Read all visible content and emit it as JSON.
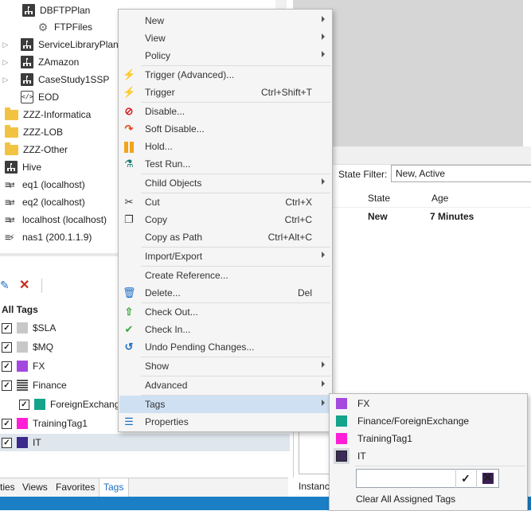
{
  "tree": {
    "rows": [
      {
        "label": "DBFTPPlan",
        "icon": "plan-icon"
      },
      {
        "label": "FTPFiles",
        "icon": "gear-icon"
      },
      {
        "label": "ServiceLibraryPlan",
        "icon": "plan-icon"
      },
      {
        "label": "ZAmazon",
        "icon": "plan-icon"
      },
      {
        "label": "CaseStudy1SSP",
        "icon": "plan-icon"
      },
      {
        "label": "EOD",
        "icon": "code-icon"
      },
      {
        "label": "ZZZ-Informatica",
        "icon": "folder-icon"
      },
      {
        "label": "ZZZ-LOB",
        "icon": "folder-icon"
      },
      {
        "label": "ZZZ-Other",
        "icon": "folder-icon"
      },
      {
        "label": "Hive",
        "icon": "plan-icon"
      },
      {
        "label": "eq1 (localhost)",
        "icon": "agent-icon"
      },
      {
        "label": "eq2 (localhost)",
        "icon": "agent-icon"
      },
      {
        "label": "localhost (localhost)",
        "icon": "agent-icon"
      },
      {
        "label": "nas1 (200.1.1.9)",
        "icon": "agent-icon"
      }
    ]
  },
  "tags_pane": {
    "header": "All Tags",
    "items": [
      {
        "label": "$SLA",
        "color": "#c8c8c8",
        "checked": true
      },
      {
        "label": "$MQ",
        "color": "#c8c8c8",
        "checked": true
      },
      {
        "label": "FX",
        "color": "#a349e0",
        "checked": true
      },
      {
        "label": "Finance",
        "color": "#555555",
        "checked": true
      },
      {
        "label": "ForeignExchange",
        "color": "#14a38b",
        "checked": true
      },
      {
        "label": "TrainingTag1",
        "color": "#ff1ed6",
        "checked": true
      },
      {
        "label": "IT",
        "color": "#3b2a8c",
        "checked": true
      }
    ]
  },
  "bottom_tabs": [
    "ties",
    "Views",
    "Favorites",
    "Tags"
  ],
  "right_panel": {
    "state_filter_label": "State Filter:",
    "state_filter_value": "New, Active",
    "columns": [
      "State",
      "Age"
    ],
    "row": {
      "state": "New",
      "age": "7 Minutes"
    },
    "bottom_tab": "Instanc"
  },
  "context_menu": {
    "items": [
      {
        "label": "New",
        "submenu": true
      },
      {
        "label": "View",
        "submenu": true
      },
      {
        "label": "Policy",
        "submenu": true
      },
      {
        "label": "Trigger (Advanced)...",
        "icon": "trigger-advanced-icon"
      },
      {
        "label": "Trigger",
        "shortcut": "Ctrl+Shift+T",
        "icon": "lightning-icon"
      },
      {
        "label": "Disable...",
        "icon": "disable-icon"
      },
      {
        "label": "Soft Disable...",
        "icon": "soft-disable-icon"
      },
      {
        "label": "Hold...",
        "icon": "hold-icon"
      },
      {
        "label": "Test Run...",
        "icon": "flask-icon"
      },
      {
        "label": "Child Objects",
        "submenu": true
      },
      {
        "label": "Cut",
        "shortcut": "Ctrl+X",
        "icon": "scissors-icon"
      },
      {
        "label": "Copy",
        "shortcut": "Ctrl+C",
        "icon": "copy-icon"
      },
      {
        "label": "Copy as Path",
        "shortcut": "Ctrl+Alt+C"
      },
      {
        "label": "Import/Export",
        "submenu": true
      },
      {
        "label": "Create Reference..."
      },
      {
        "label": "Delete...",
        "shortcut": "Del",
        "icon": "trash-icon"
      },
      {
        "label": "Check Out...",
        "icon": "check-out-icon"
      },
      {
        "label": "Check In...",
        "icon": "check-in-icon"
      },
      {
        "label": "Undo Pending Changes...",
        "icon": "undo-icon"
      },
      {
        "label": "Show",
        "submenu": true
      },
      {
        "label": "Advanced",
        "submenu": true
      },
      {
        "label": "Tags",
        "submenu": true
      },
      {
        "label": "Properties",
        "icon": "properties-icon"
      }
    ]
  },
  "tags_submenu": {
    "items": [
      {
        "label": "FX",
        "color": "#a349e0"
      },
      {
        "label": "Finance/ForeignExchange",
        "color": "#14a38b"
      },
      {
        "label": "TrainingTag1",
        "color": "#ff1ed6"
      },
      {
        "label": "IT",
        "color": "#3b2a5c"
      }
    ],
    "clear_label": "Clear All Assigned Tags",
    "input_color": "#3b1f55",
    "confirm_glyph": "✓",
    "cancel_glyph": "✕"
  }
}
